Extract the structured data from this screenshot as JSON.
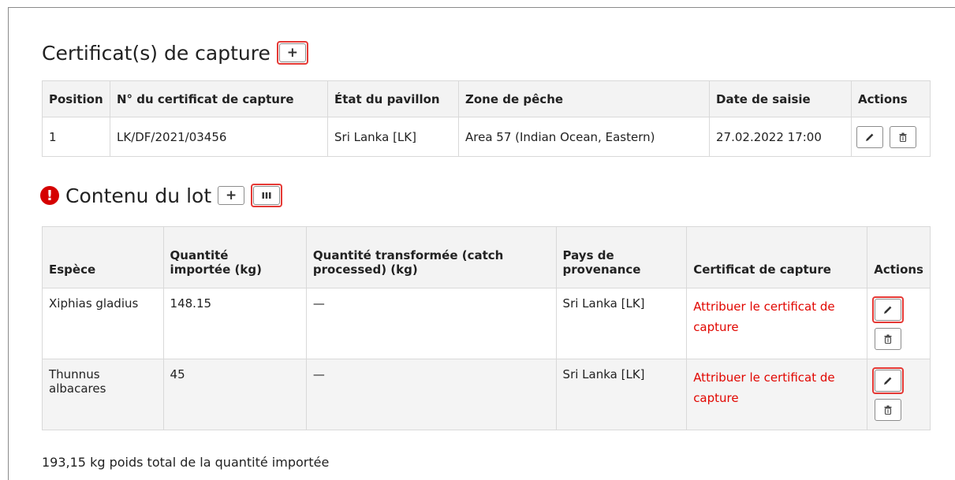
{
  "catch_section": {
    "title": "Certificat(s) de capture",
    "columns": [
      "Position",
      "N° du certificat de capture",
      "État du pavillon",
      "Zone de pêche",
      "Date de saisie",
      "Actions"
    ],
    "rows": [
      {
        "position": "1",
        "certificate_no": "LK/DF/2021/03456",
        "flag_state": "Sri Lanka [LK]",
        "fishing_zone": "Area 57 (Indian Ocean, Eastern)",
        "date": "27.02.2022 17:00"
      }
    ]
  },
  "lot_section": {
    "title": "Contenu du lot",
    "columns": {
      "species": "Espèce",
      "qty_line1": "Quantité",
      "qty_line2": "importée (kg)",
      "proc_line1": "Quantité transformée (catch",
      "proc_line2": "processed) (kg)",
      "country_line1": "Pays de",
      "country_line2": "provenance",
      "certificate": "Certificat de capture",
      "actions": "Actions"
    },
    "rows": [
      {
        "species": "Xiphias gladius",
        "quantity": "148.15",
        "processed": "—",
        "country": "Sri Lanka [LK]",
        "cert_line1": "Attribuer le certificat de",
        "cert_line2": "capture"
      },
      {
        "species_line1": "Thunnus",
        "species_line2": "albacares",
        "quantity": "45",
        "processed": "—",
        "country": "Sri Lanka [LK]",
        "cert_line1": "Attribuer le certificat de",
        "cert_line2": "capture"
      }
    ]
  },
  "total_text": "193,15 kg poids total de la quantité importée",
  "icons": {
    "add": "plus-icon",
    "columns": "columns-icon",
    "edit": "pencil-icon",
    "delete": "trash-icon",
    "alert": "exclamation-icon"
  },
  "colors": {
    "highlight": "#e53935",
    "link_red": "#e10600",
    "alert_red": "#d50000"
  }
}
